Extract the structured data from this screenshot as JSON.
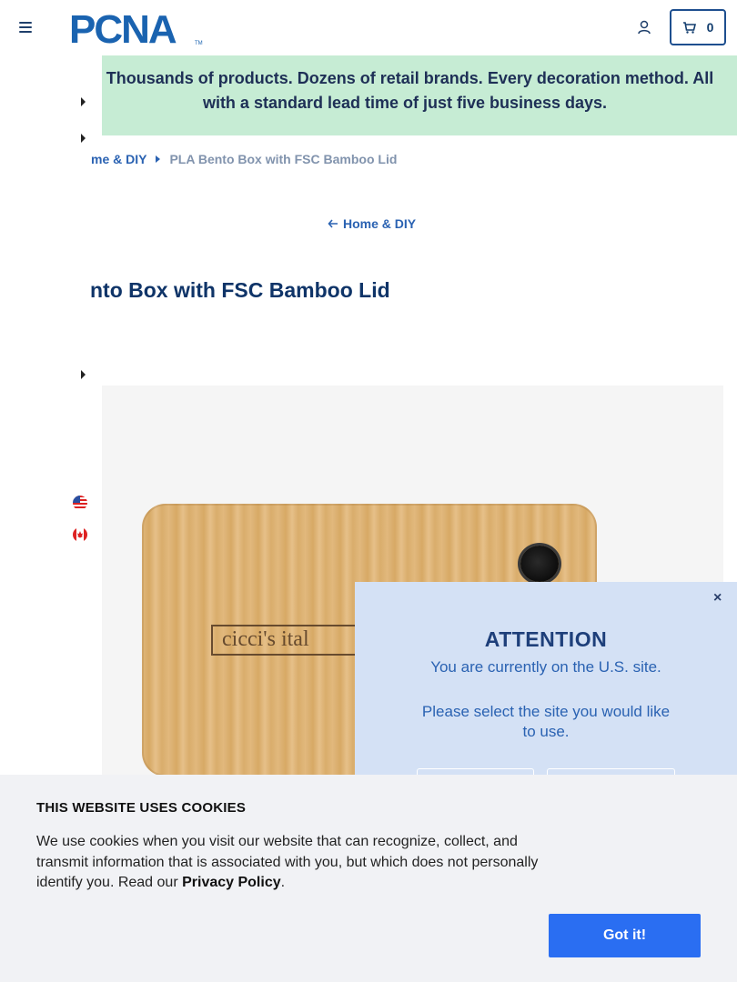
{
  "header": {
    "logo_text": "PCNA",
    "cart_count": "0"
  },
  "promo": {
    "line1": "! Thousands of products. Dozens of retail brands. Every decoration method. All",
    "line2": "with a standard lead time of just five business days."
  },
  "breadcrumb": {
    "parent": "me & DIY",
    "current": "PLA Bento Box with FSC Bamboo Lid"
  },
  "back_link": "Home & DIY",
  "product": {
    "title": "nto Box with FSC Bamboo Lid",
    "engraving": "cicci's ital"
  },
  "attention": {
    "close": "×",
    "title": "ATTENTION",
    "message": "You are currently on the U.S. site.",
    "prompt": "Please select the site you would like to use."
  },
  "cookie": {
    "title": "THIS WEBSITE USES COOKIES",
    "text_before": "We use cookies when you visit our website that can recognize, collect, and transmit information that is associated with you, but which does not personally identify you. Read our ",
    "link": "Privacy Policy",
    "text_after": ".",
    "button": "Got it!"
  },
  "colors": {
    "brand_blue": "#1e5aa8",
    "promo_bg": "#c6ecd4",
    "attention_bg": "#d4e1f5",
    "cookie_button": "#2a6ef2"
  }
}
